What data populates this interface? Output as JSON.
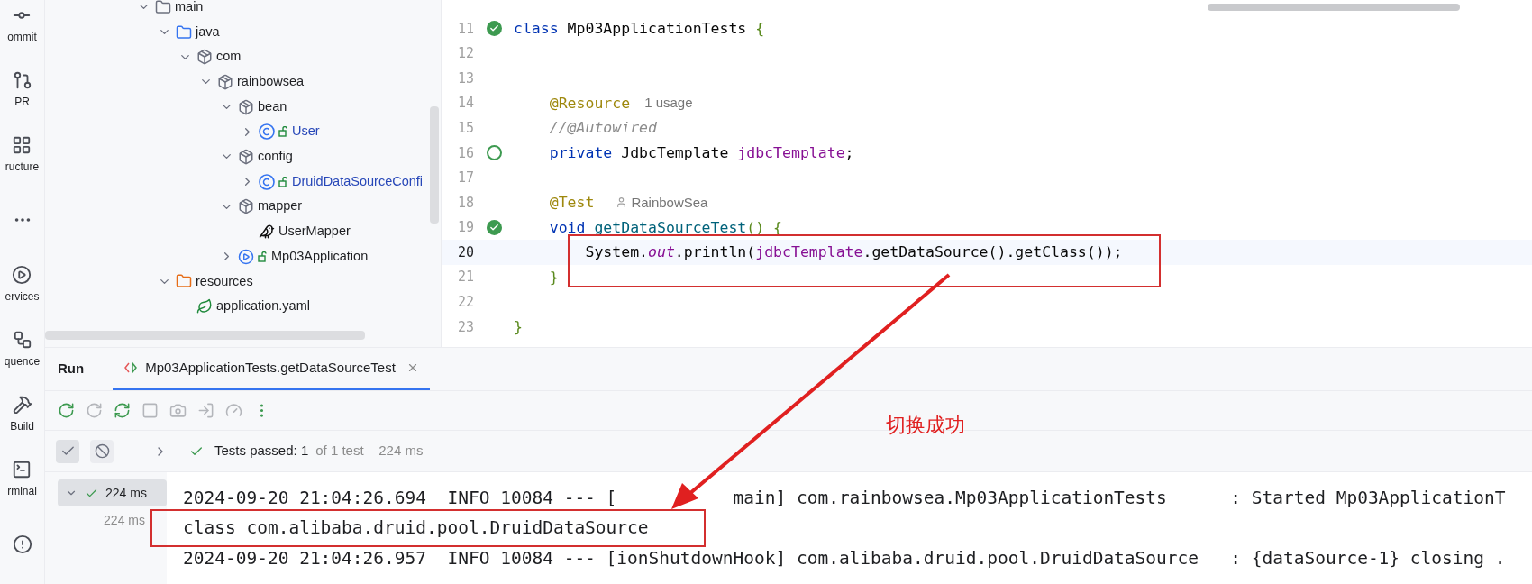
{
  "tool_strip": [
    {
      "kind": "commit",
      "label": "ommit"
    },
    {
      "kind": "pr",
      "label": "PR"
    },
    {
      "kind": "structure",
      "label": "ructure"
    },
    {
      "kind": "more"
    },
    {
      "kind": "services",
      "label": "ervices"
    },
    {
      "kind": "sequence",
      "label": "quence"
    },
    {
      "kind": "build",
      "label": "Build"
    },
    {
      "kind": "terminal",
      "label": "rminal"
    },
    {
      "kind": "problems"
    }
  ],
  "project_tree": [
    {
      "label": "main",
      "kind": "folder",
      "expanded": true,
      "children": [
        {
          "label": "java",
          "kind": "source-folder",
          "expanded": true,
          "children": [
            {
              "label": "com",
              "kind": "package",
              "expanded": true,
              "children": [
                {
                  "label": "rainbowsea",
                  "kind": "package",
                  "expanded": true,
                  "children": [
                    {
                      "label": "bean",
                      "kind": "package",
                      "expanded": true,
                      "children": [
                        {
                          "label": "User",
                          "kind": "class",
                          "expanded": false
                        }
                      ]
                    },
                    {
                      "label": "config",
                      "kind": "package",
                      "expanded": true,
                      "children": [
                        {
                          "label": "DruidDataSourceConfi",
                          "kind": "class",
                          "expanded": false
                        }
                      ]
                    },
                    {
                      "label": "mapper",
                      "kind": "package",
                      "expanded": true,
                      "children": [
                        {
                          "label": "UserMapper",
                          "kind": "mapper"
                        }
                      ]
                    },
                    {
                      "label": "Mp03Application",
                      "kind": "app",
                      "expanded": false
                    }
                  ]
                }
              ]
            }
          ]
        },
        {
          "label": "resources",
          "kind": "resources",
          "expanded": true,
          "children": [
            {
              "label": "application.yaml",
              "kind": "yaml"
            }
          ]
        }
      ]
    }
  ],
  "editor": {
    "lines": [
      {
        "number": "11",
        "gutter": {
          "kind": "run"
        },
        "current": false,
        "tokens": [
          {
            "text": "class ",
            "kind": "keyword"
          },
          {
            "text": "Mp03ApplicationTests ",
            "kind": "plain"
          },
          {
            "text": "{",
            "kind": "brace"
          }
        ]
      },
      {
        "number": "12",
        "current": false
      },
      {
        "number": "13",
        "current": false
      },
      {
        "number": "14",
        "current": false,
        "tokens": [
          {
            "text": "    @Resource",
            "kind": "annotation"
          },
          {
            "text": "1 usage",
            "kind": "hint"
          }
        ]
      },
      {
        "number": "15",
        "current": false,
        "tokens": [
          {
            "text": "    //@Autowired",
            "kind": "comment"
          }
        ]
      },
      {
        "number": "16",
        "gutter": {
          "kind": "bean"
        },
        "current": false,
        "tokens": [
          {
            "text": "    private ",
            "kind": "keyword"
          },
          {
            "text": "JdbcTemplate ",
            "kind": "plain"
          },
          {
            "text": "jdbcTemplate",
            "kind": "field"
          },
          {
            "text": ";",
            "kind": "plain"
          }
        ]
      },
      {
        "number": "17",
        "current": false
      },
      {
        "number": "18",
        "current": false,
        "tokens": [
          {
            "text": "    @Test",
            "kind": "annotation"
          },
          {
            "text": "RainbowSea",
            "kind": "author"
          }
        ]
      },
      {
        "number": "19",
        "gutter": {
          "kind": "run"
        },
        "current": false,
        "tokens": [
          {
            "text": "    void ",
            "kind": "keyword"
          },
          {
            "text": "getDataSourceTest",
            "kind": "method"
          },
          {
            "text": "() {",
            "kind": "brace"
          }
        ]
      },
      {
        "number": "20",
        "current": true,
        "tokens": [
          {
            "text": "        System.",
            "kind": "plain"
          },
          {
            "text": "out",
            "kind": "static"
          },
          {
            "text": ".println(",
            "kind": "plain"
          },
          {
            "text": "jdbcTemplate",
            "kind": "field"
          },
          {
            "text": ".getDataSource().getClass());",
            "kind": "plain"
          }
        ]
      },
      {
        "number": "21",
        "current": false,
        "tokens": [
          {
            "text": "    }",
            "kind": "brace"
          }
        ]
      },
      {
        "number": "22",
        "current": false
      },
      {
        "number": "23",
        "current": false,
        "tokens": [
          {
            "text": "}",
            "kind": "brace"
          }
        ]
      }
    ]
  },
  "run_panel": {
    "title": "Run",
    "tabs": [
      {
        "label": "Mp03ApplicationTests.getDataSourceTest",
        "selected": true
      }
    ],
    "toolbar": [
      {
        "kind": "rerun",
        "disabled": false
      },
      {
        "kind": "rerun-failed",
        "disabled": true
      },
      {
        "kind": "toggle-rerun",
        "disabled": false
      },
      {
        "kind": "stop",
        "disabled": true
      },
      {
        "kind": "camera",
        "disabled": true
      },
      {
        "kind": "export",
        "disabled": true
      },
      {
        "kind": "gauge",
        "disabled": true
      },
      {
        "kind": "more",
        "disabled": false
      }
    ],
    "filters": [
      {
        "kind": "passed",
        "selected": true
      },
      {
        "kind": "ignored",
        "selected": false
      }
    ],
    "status": {
      "main": "Tests passed: 1",
      "detail": "of 1 test – 224 ms"
    },
    "test_tree": [
      {
        "label": "224 ms",
        "selected": true,
        "children": [
          {
            "label": "224 ms"
          }
        ]
      }
    ],
    "console": [
      "2024-09-20 21:04:26.694  INFO 10084 --- [           main] com.rainbowsea.Mp03ApplicationTests      : Started Mp03ApplicationT",
      "class com.alibaba.druid.pool.DruidDataSource",
      "2024-09-20 21:04:26.957  INFO 10084 --- [ionShutdownHook] com.alibaba.druid.pool.DruidDataSource   : {dataSource-1} closing ."
    ]
  },
  "annotation": {
    "label": "切换成功"
  }
}
